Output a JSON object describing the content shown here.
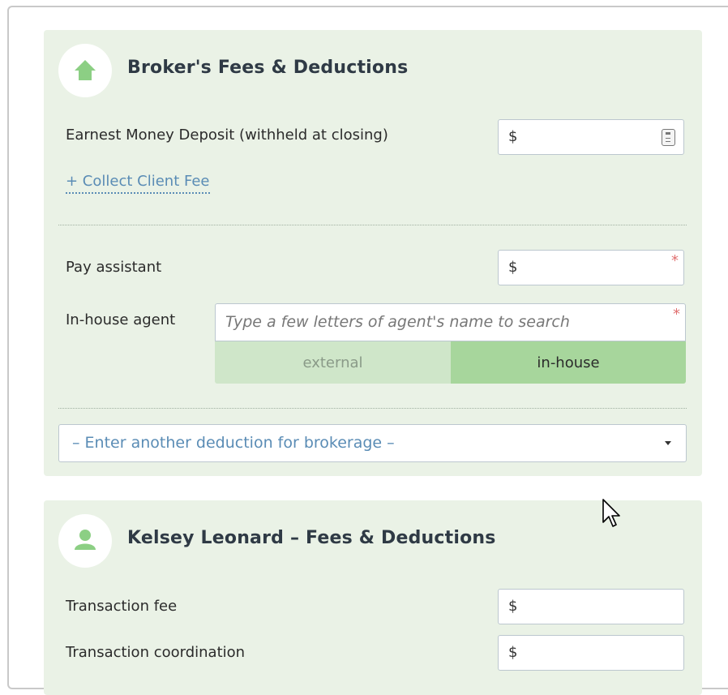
{
  "broker_section": {
    "title": "Broker's Fees & Deductions",
    "icon": "home-icon",
    "earnest_money": {
      "label": "Earnest Money Deposit (withheld at closing)",
      "currency": "$",
      "value": ""
    },
    "collect_client_fee_link": "+ Collect Client Fee",
    "pay_assistant": {
      "label": "Pay assistant",
      "currency": "$",
      "value": "",
      "required_mark": "*"
    },
    "in_house_agent": {
      "label": "In-house agent",
      "placeholder": "Type a few letters of agent's name to search",
      "required_mark": "*",
      "toggle": {
        "external": "external",
        "in_house": "in-house",
        "selected": "in-house"
      }
    },
    "deduction_select": {
      "selected": "– Enter another deduction for brokerage –"
    }
  },
  "agent_section": {
    "title": "Kelsey Leonard – Fees & Deductions",
    "icon": "user-icon",
    "transaction_fee": {
      "label": "Transaction fee",
      "currency": "$",
      "value": ""
    },
    "transaction_coordination": {
      "label": "Transaction coordination",
      "currency": "$",
      "value": ""
    }
  },
  "colors": {
    "panel_bg": "#eaf2e6",
    "accent_green": "#a7d69c",
    "link_blue": "#5a8cb5",
    "required_red": "#e07070"
  }
}
